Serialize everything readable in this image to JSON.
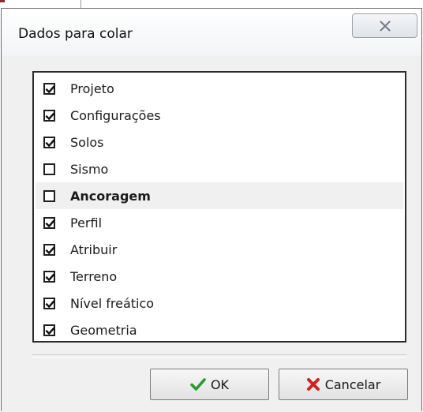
{
  "dialog": {
    "title": "Dados para colar",
    "close_icon": "close-x-icon"
  },
  "items": [
    {
      "label": "Projeto",
      "checked": true
    },
    {
      "label": "Configurações",
      "checked": true
    },
    {
      "label": "Solos",
      "checked": true
    },
    {
      "label": "Sismo",
      "checked": false
    },
    {
      "label": "Ancoragem",
      "checked": false,
      "selected": true
    },
    {
      "label": "Perfil",
      "checked": true
    },
    {
      "label": "Atribuir",
      "checked": true
    },
    {
      "label": "Terreno",
      "checked": true
    },
    {
      "label": "Nível freático",
      "checked": true
    },
    {
      "label": "Geometria",
      "checked": true
    }
  ],
  "buttons": {
    "ok": {
      "label": "OK",
      "icon": "green-check-icon"
    },
    "cancel": {
      "label": "Cancelar",
      "icon": "red-x-icon"
    }
  },
  "colors": {
    "check_green": "#2a9a2a",
    "cancel_red": "#d2201f"
  }
}
